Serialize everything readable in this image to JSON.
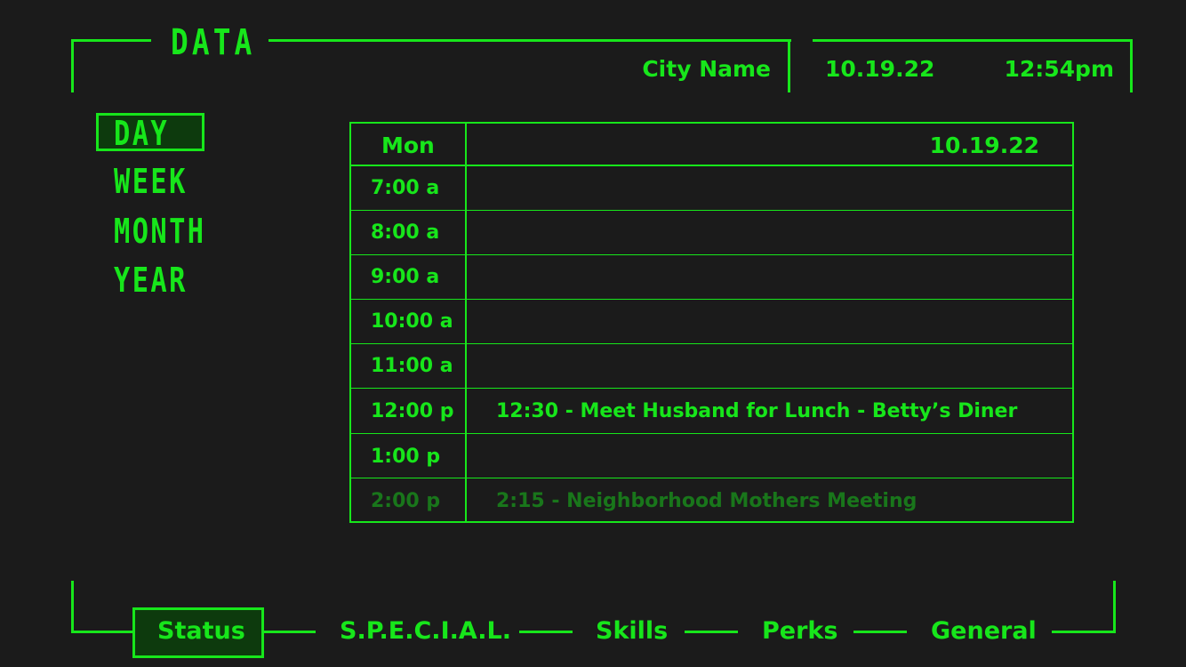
{
  "header": {
    "title": "DATA",
    "city": "City Name",
    "date": "10.19.22",
    "time": "12:54pm"
  },
  "nav": {
    "items": [
      {
        "label": "DAY",
        "active": true
      },
      {
        "label": "WEEK",
        "active": false
      },
      {
        "label": "MONTH",
        "active": false
      },
      {
        "label": "YEAR",
        "active": false
      }
    ]
  },
  "schedule": {
    "day": "Mon",
    "date": "10.19.22",
    "rows": [
      {
        "time": "7:00 a",
        "event": ""
      },
      {
        "time": "8:00 a",
        "event": ""
      },
      {
        "time": "9:00 a",
        "event": ""
      },
      {
        "time": "10:00 a",
        "event": ""
      },
      {
        "time": "11:00 a",
        "event": ""
      },
      {
        "time": "12:00 p",
        "event": "12:30 - Meet Husband for Lunch - Betty’s Diner"
      },
      {
        "time": "1:00 p",
        "event": ""
      },
      {
        "time": "2:00 p",
        "event": "2:15 - Neighborhood Mothers Meeting"
      }
    ]
  },
  "tabs": [
    {
      "label": "Status",
      "active": true
    },
    {
      "label": "S.P.E.C.I.A.L.",
      "active": false
    },
    {
      "label": "Skills",
      "active": false
    },
    {
      "label": "Perks",
      "active": false
    },
    {
      "label": "General",
      "active": false
    }
  ],
  "colors": {
    "accent": "#17e61b",
    "background": "#1b1b1b",
    "active_fill": "#0d3a0d"
  }
}
